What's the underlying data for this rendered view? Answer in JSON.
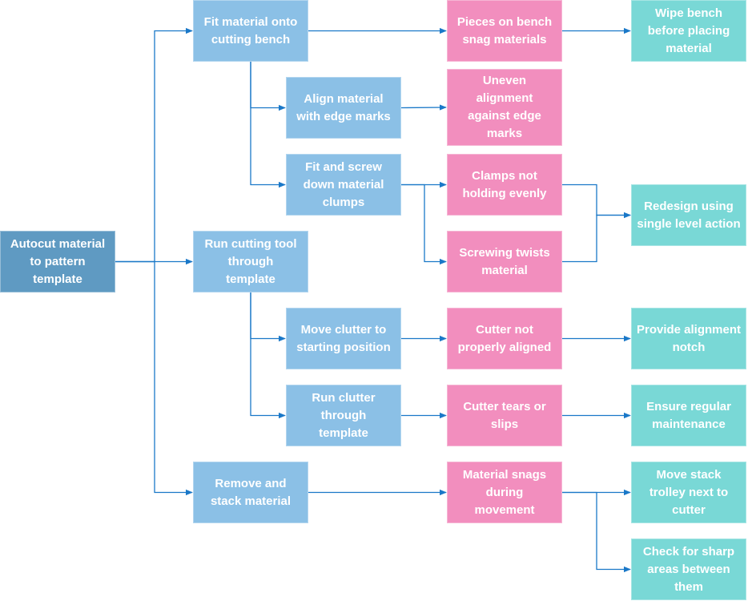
{
  "diagram": {
    "type": "cause-and-effect flow",
    "colors": {
      "root": "#5f9ac2",
      "step": "#8bc0e6",
      "cause": "#f28ebe",
      "fix": "#79d8d6",
      "connector": "#1a78c8"
    },
    "nodes": [
      {
        "id": "root",
        "kind": "root",
        "label": "Autocut material\nto pattern\ntemplate"
      },
      {
        "id": "fit-material",
        "kind": "step",
        "label": "Fit material onto\ncutting bench"
      },
      {
        "id": "align-material",
        "kind": "step",
        "label": "Align material\nwith edge marks"
      },
      {
        "id": "fit-screw",
        "kind": "step",
        "label": "Fit and screw\ndown material\nclumps"
      },
      {
        "id": "run-cutting-tool",
        "kind": "step",
        "label": "Run cutting tool\nthrough\ntemplate"
      },
      {
        "id": "move-clutter",
        "kind": "step",
        "label": "Move clutter to\nstarting position"
      },
      {
        "id": "run-clutter",
        "kind": "step",
        "label": "Run clutter\nthrough\ntemplate"
      },
      {
        "id": "remove-stack",
        "kind": "step",
        "label": "Remove and\nstack material"
      },
      {
        "id": "pieces-snag",
        "kind": "cause",
        "label": "Pieces on bench\nsnag materials"
      },
      {
        "id": "uneven-alignment",
        "kind": "cause",
        "label": "Uneven\nalignment\nagainst edge\nmarks"
      },
      {
        "id": "clamps-uneven",
        "kind": "cause",
        "label": "Clamps not\nholding evenly"
      },
      {
        "id": "screwing-twists",
        "kind": "cause",
        "label": "Screwing twists\nmaterial"
      },
      {
        "id": "cutter-misaligned",
        "kind": "cause",
        "label": "Cutter not\nproperly aligned"
      },
      {
        "id": "cutter-tears",
        "kind": "cause",
        "label": "Cutter tears or\nslips"
      },
      {
        "id": "material-snags",
        "kind": "cause",
        "label": "Material snags\nduring\nmovement"
      },
      {
        "id": "wipe-bench",
        "kind": "fix",
        "label": "Wipe bench\nbefore placing\nmaterial"
      },
      {
        "id": "redesign",
        "kind": "fix",
        "label": "Redesign using\nsingle level action"
      },
      {
        "id": "alignment-notch",
        "kind": "fix",
        "label": "Provide alignment\nnotch"
      },
      {
        "id": "regular-maintenance",
        "kind": "fix",
        "label": "Ensure regular\nmaintenance"
      },
      {
        "id": "move-trolley",
        "kind": "fix",
        "label": "Move stack\ntrolley next to\ncutter"
      },
      {
        "id": "check-sharp",
        "kind": "fix",
        "label": "Check for sharp\nareas between\nthem"
      }
    ],
    "edges": [
      {
        "from": "root",
        "to": "fit-material"
      },
      {
        "from": "root",
        "to": "run-cutting-tool"
      },
      {
        "from": "root",
        "to": "remove-stack"
      },
      {
        "from": "fit-material",
        "to": "align-material"
      },
      {
        "from": "fit-material",
        "to": "fit-screw"
      },
      {
        "from": "fit-material",
        "to": "pieces-snag"
      },
      {
        "from": "align-material",
        "to": "uneven-alignment"
      },
      {
        "from": "fit-screw",
        "to": "clamps-uneven"
      },
      {
        "from": "fit-screw",
        "to": "screwing-twists"
      },
      {
        "from": "clamps-uneven",
        "to": "redesign"
      },
      {
        "from": "screwing-twists",
        "to": "redesign"
      },
      {
        "from": "pieces-snag",
        "to": "wipe-bench"
      },
      {
        "from": "run-cutting-tool",
        "to": "move-clutter"
      },
      {
        "from": "run-cutting-tool",
        "to": "run-clutter"
      },
      {
        "from": "move-clutter",
        "to": "cutter-misaligned"
      },
      {
        "from": "cutter-misaligned",
        "to": "alignment-notch"
      },
      {
        "from": "run-clutter",
        "to": "cutter-tears"
      },
      {
        "from": "cutter-tears",
        "to": "regular-maintenance"
      },
      {
        "from": "remove-stack",
        "to": "material-snags"
      },
      {
        "from": "material-snags",
        "to": "move-trolley"
      },
      {
        "from": "material-snags",
        "to": "check-sharp"
      }
    ]
  }
}
